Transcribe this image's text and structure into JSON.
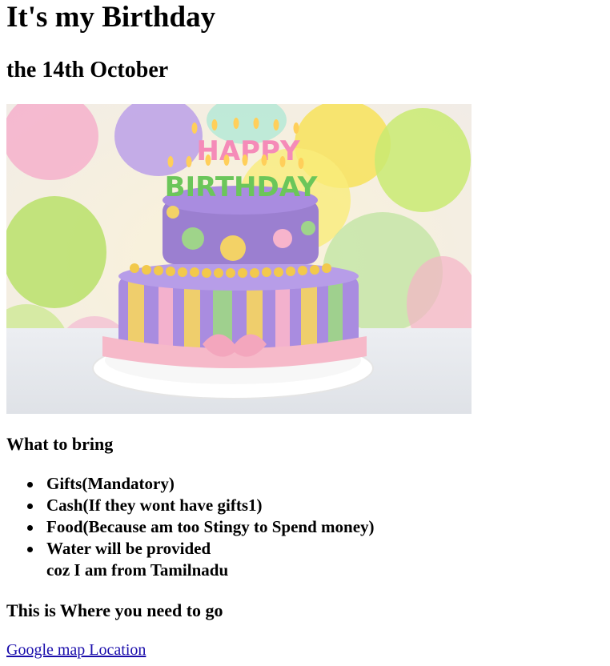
{
  "page": {
    "title": "It's my Birthday",
    "date": "the 14th October"
  },
  "hero_image": {
    "alt": "Birthday cake",
    "candle_letters_top": "HAPPY",
    "candle_letters_bottom": "BIRTHDAY"
  },
  "bring_section": {
    "heading": "What to bring",
    "items": [
      {
        "lines": [
          "Gifts(Mandatory)"
        ]
      },
      {
        "lines": [
          "Cash(If they wont have gifts1)"
        ]
      },
      {
        "lines": [
          "Food(Because am too Stingy to Spend money)"
        ]
      },
      {
        "lines": [
          "Water will be provided",
          "coz I am from Tamilnadu"
        ]
      }
    ]
  },
  "location_section": {
    "heading": "This is Where you need to go",
    "link_label": "Google map Location"
  },
  "colors": {
    "link": "#1a0dab",
    "text": "#000000",
    "cake_top": "#9b7fd0",
    "cake_bottom": "#a98ce0",
    "ribbon": "#f6b9c9"
  }
}
